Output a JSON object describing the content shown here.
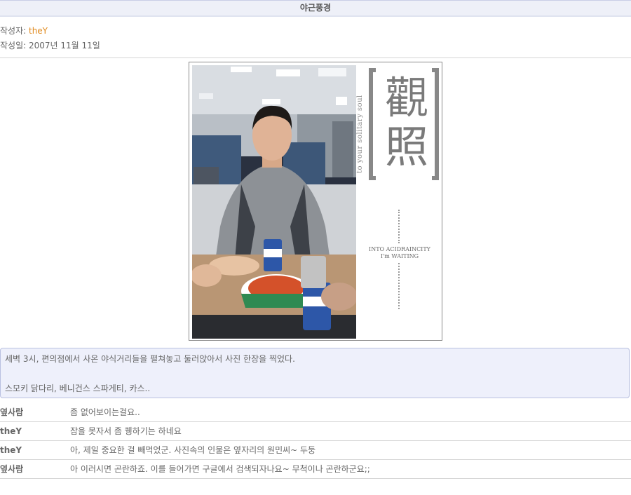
{
  "header": {
    "title": "야근풍경"
  },
  "meta": {
    "author_label": "작성자: ",
    "author_name": "theY",
    "date_label": "작성일: ",
    "date": "2007년 11월 11일"
  },
  "photo": {
    "kanji_top": "觀",
    "kanji_bottom": "照",
    "vertical_caption": "to your solitary soul",
    "side_line1": "INTO ACIDRAINCITY",
    "side_line2": "I'm WAITING"
  },
  "description": {
    "line1": "세벽 3시, 편의점에서 사온 야식거리들을 펼쳐놓고 둘러앉아서 사진 한장을 찍었다.",
    "line2": "스모키 닭다리, 베니건스 스파게티, 카스.."
  },
  "comments": [
    {
      "author": "옆사람",
      "text": "좀 없어보이는걸요.."
    },
    {
      "author": "theY",
      "text": "잠을 못자서 좀 퀭하기는 하네요"
    },
    {
      "author": "theY",
      "text": "아, 제일 중요한 걸 빼먹었군. 사진속의 인물은 옆자리의 원민씨~ 두둥"
    },
    {
      "author": "옆사람",
      "text": "아 이러시면 곤란하죠. 이를 들어가면 구글에서 검색되자나요~ 무척이나 곤란하군요;;"
    }
  ]
}
